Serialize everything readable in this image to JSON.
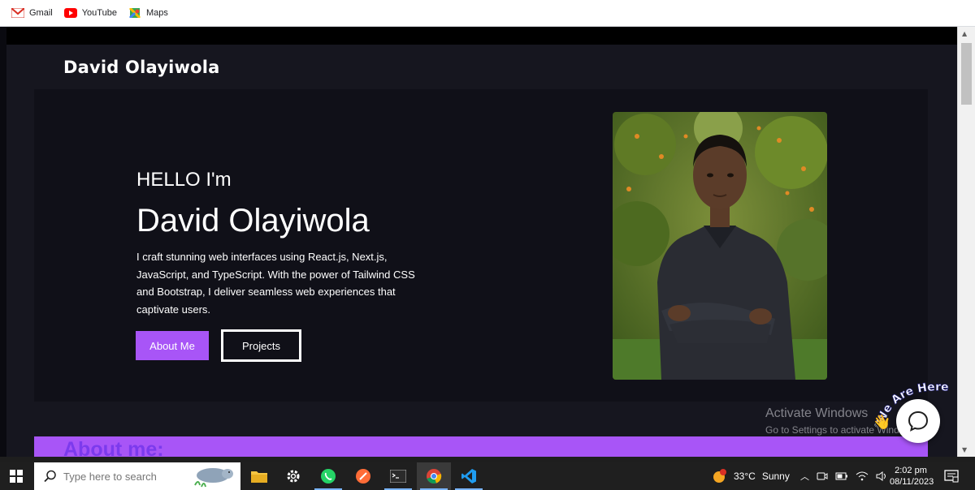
{
  "bookmarks": [
    {
      "label": "Gmail",
      "icon": "gmail-icon"
    },
    {
      "label": "YouTube",
      "icon": "youtube-icon"
    },
    {
      "label": "Maps",
      "icon": "maps-icon"
    }
  ],
  "site": {
    "logo": "David Olayiwola",
    "hero": {
      "greeting": "HELLO I'm",
      "name": "David Olayiwola",
      "description": "I craft stunning web interfaces using React.js, Next.js, JavaScript, and TypeScript. With the power of Tailwind CSS and Bootstrap, I deliver seamless web experiences that captivate users.",
      "about_button": "About Me",
      "projects_button": "Projects"
    },
    "about_heading": "About me:"
  },
  "chat": {
    "badge_text": "We Are Here!"
  },
  "watermark": {
    "line1": "Activate Windows",
    "line2": "Go to Settings to activate Windows."
  },
  "taskbar": {
    "search_placeholder": "Type here to search",
    "weather_temp": "33°C",
    "weather_condition": "Sunny",
    "weather_alert_count": "1",
    "time": "2:02 pm",
    "date": "08/11/2023"
  },
  "colors": {
    "accent": "#a855f7",
    "background": "#16161f",
    "hero_bg": "#101018"
  }
}
